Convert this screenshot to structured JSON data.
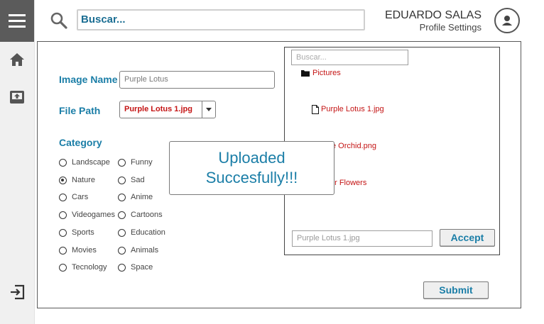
{
  "header": {
    "search_placeholder": "Buscar...",
    "user_name": "EDUARDO SALAS",
    "profile_settings": "Profile Settings"
  },
  "sidebar": {
    "icons": [
      "menu-icon",
      "home-icon",
      "upload-icon",
      "logout-icon"
    ]
  },
  "form": {
    "image_name_label": "Image Name",
    "image_name_value": "Purple Lotus",
    "file_path_label": "File Path",
    "file_path_value": "Purple Lotus 1.jpg",
    "category_label": "Category",
    "categories_col1": [
      "Landscape",
      "Nature",
      "Cars",
      "Videogames",
      "Sports",
      "Movies",
      "Tecnology"
    ],
    "categories_col2": [
      "Funny",
      "Sad",
      "Anime",
      "Cartoons",
      "Education",
      "Animals",
      "Space"
    ],
    "selected_category": "Nature",
    "submit_label": "Submit"
  },
  "file_browser": {
    "search_placeholder": "Buscar...",
    "folder": "Pictures",
    "file1": "Purple Lotus 1.jpg",
    "file2_partial": "e Orchid.png",
    "file3_partial": "er Flowers",
    "filename_value": "Purple Lotus 1.jpg",
    "accept_label": "Accept"
  },
  "toast": {
    "line1": "Uploaded",
    "line2": "Succesfully!!!"
  },
  "colors": {
    "accent": "#1b7ea7",
    "file_red": "#c41414",
    "sidebar_dark": "#5b5b5b"
  }
}
